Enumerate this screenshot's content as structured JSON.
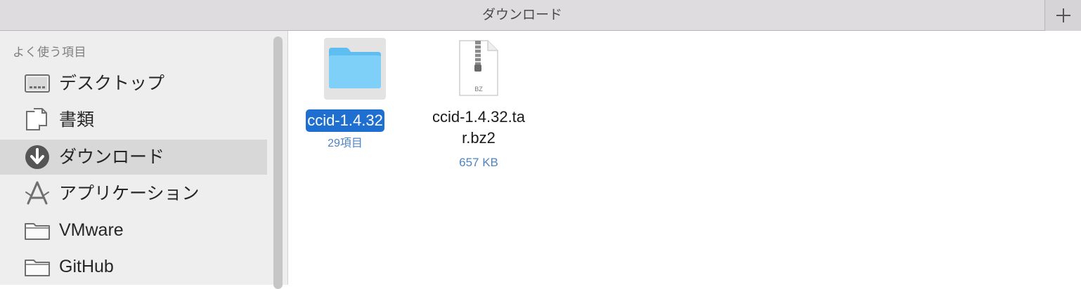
{
  "window": {
    "title": "ダウンロード",
    "new_tab_icon": "plus-icon"
  },
  "sidebar": {
    "section_title": "よく使う項目",
    "items": [
      {
        "label": "デスクトップ",
        "icon": "desktop-icon",
        "selected": false
      },
      {
        "label": "書類",
        "icon": "documents-icon",
        "selected": false
      },
      {
        "label": "ダウンロード",
        "icon": "downloads-icon",
        "selected": true
      },
      {
        "label": "アプリケーション",
        "icon": "applications-icon",
        "selected": false
      },
      {
        "label": "VMware",
        "icon": "folder-icon",
        "selected": false
      },
      {
        "label": "GitHub",
        "icon": "folder-icon",
        "selected": false
      }
    ]
  },
  "files": [
    {
      "name": "ccid-1.4.32",
      "meta": "29項目",
      "type": "folder",
      "selected": true
    },
    {
      "name_line1": "ccid-1.4.32.ta",
      "name_line2": "r.bz2",
      "meta": "657 KB",
      "type": "bz2-archive",
      "badge": "BZ",
      "selected": false
    }
  ],
  "colors": {
    "selection": "#1f6fd1",
    "folder": "#5ebdf1",
    "meta_text": "#4f83c4",
    "sidebar_bg": "#eeeeee"
  }
}
